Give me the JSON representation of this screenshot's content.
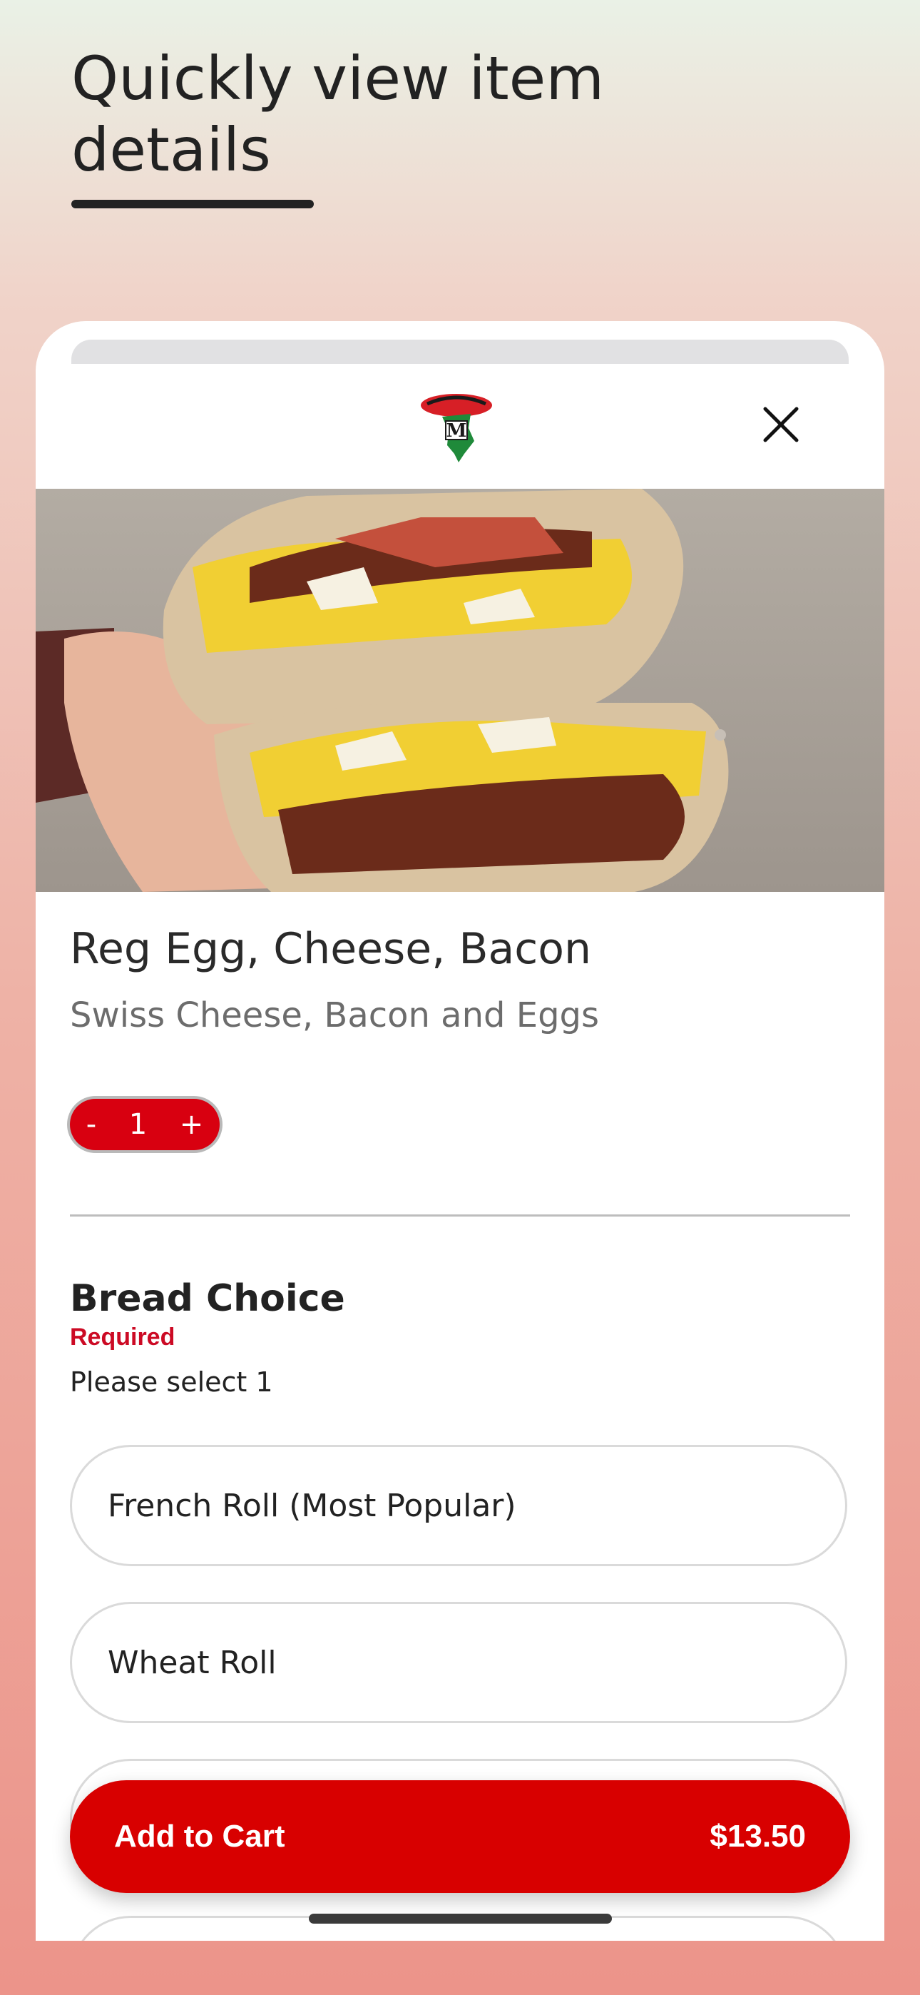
{
  "headline": "Quickly view item details",
  "brand": {
    "logo_icon": "mickeys-deli-logo",
    "logo_letter": "M"
  },
  "item": {
    "name": "Reg Egg, Cheese, Bacon",
    "description": "Swiss Cheese, Bacon and Eggs",
    "image": "egg-cheese-bacon-sandwich-photo"
  },
  "quantity": {
    "minus": "-",
    "value": "1",
    "plus": "+"
  },
  "bread_section": {
    "title": "Bread Choice",
    "required_label": "Required",
    "hint": "Please select 1",
    "options": [
      {
        "label": "French Roll (Most Popular)"
      },
      {
        "label": "Wheat Roll"
      },
      {
        "label": ""
      },
      {
        "label": ""
      }
    ]
  },
  "cart": {
    "label": "Add to Cart",
    "price": "$13.50"
  },
  "colors": {
    "accent": "#d80000",
    "required": "#cc0a24",
    "text": "#222222"
  }
}
